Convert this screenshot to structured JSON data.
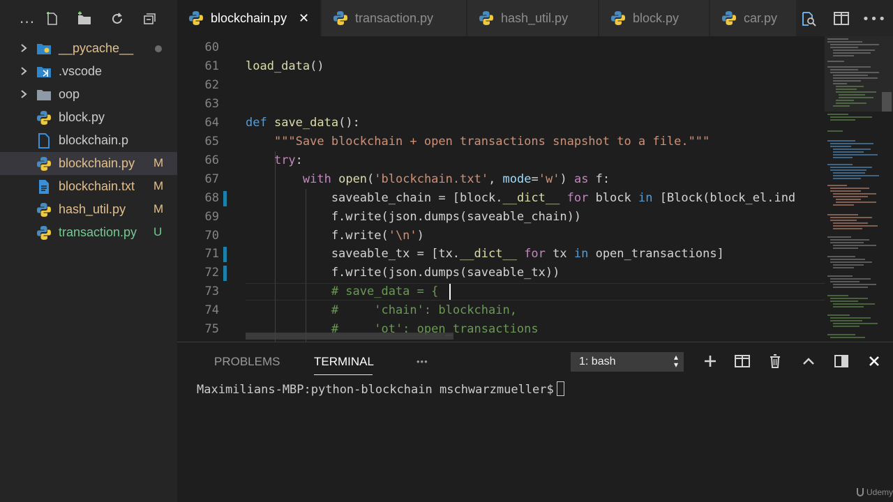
{
  "sidebar": {
    "more_label": "...",
    "items": [
      {
        "label": "__pycache__",
        "icon": "folder-python-icon",
        "color": "#e2c08d",
        "badge": "",
        "dot": true,
        "chevron": true,
        "selected": false
      },
      {
        "label": ".vscode",
        "icon": "folder-vscode-icon",
        "color": "#cccccc",
        "badge": "",
        "dot": false,
        "chevron": true,
        "selected": false
      },
      {
        "label": "oop",
        "icon": "folder-icon",
        "color": "#cccccc",
        "badge": "",
        "dot": false,
        "chevron": true,
        "selected": false
      },
      {
        "label": "block.py",
        "icon": "python-file-icon",
        "color": "#cccccc",
        "badge": "",
        "dot": false,
        "chevron": false,
        "selected": false
      },
      {
        "label": "blockchain.p",
        "icon": "file-icon",
        "color": "#cccccc",
        "badge": "",
        "dot": false,
        "chevron": false,
        "selected": false
      },
      {
        "label": "blockchain.py",
        "icon": "python-file-icon",
        "color": "#e2c08d",
        "badge": "M",
        "dot": false,
        "chevron": false,
        "selected": true
      },
      {
        "label": "blockchain.txt",
        "icon": "text-file-icon",
        "color": "#e2c08d",
        "badge": "M",
        "dot": false,
        "chevron": false,
        "selected": false
      },
      {
        "label": "hash_util.py",
        "icon": "python-file-icon",
        "color": "#e2c08d",
        "badge": "M",
        "dot": false,
        "chevron": false,
        "selected": false
      },
      {
        "label": "transaction.py",
        "icon": "python-file-icon",
        "color": "#73c991",
        "badge": "U",
        "dot": false,
        "chevron": false,
        "selected": false
      }
    ]
  },
  "tabs": [
    {
      "label": "blockchain.py",
      "active": true,
      "close": "✕"
    },
    {
      "label": "transaction.py",
      "active": false
    },
    {
      "label": "hash_util.py",
      "active": false
    },
    {
      "label": "block.py",
      "active": false
    },
    {
      "label": "car.py",
      "active": false
    }
  ],
  "editor": {
    "lines": [
      {
        "n": "60",
        "tokens": []
      },
      {
        "n": "61",
        "tokens": [
          [
            "fn",
            "load_data"
          ],
          [
            "",
            "()"
          ]
        ]
      },
      {
        "n": "62",
        "tokens": []
      },
      {
        "n": "63",
        "tokens": []
      },
      {
        "n": "64",
        "tokens": [
          [
            "kw",
            "def"
          ],
          [
            "",
            " "
          ],
          [
            "fn",
            "save_data"
          ],
          [
            "",
            "():"
          ]
        ]
      },
      {
        "n": "65",
        "tokens": [
          [
            "",
            "    "
          ],
          [
            "str",
            "\"\"\"Save blockchain + open transactions snapshot to a file.\"\"\""
          ]
        ]
      },
      {
        "n": "66",
        "tokens": [
          [
            "",
            "    "
          ],
          [
            "kw2",
            "try"
          ],
          [
            "",
            ":"
          ]
        ]
      },
      {
        "n": "67",
        "tokens": [
          [
            "",
            "        "
          ],
          [
            "kw2",
            "with"
          ],
          [
            "",
            " "
          ],
          [
            "fn",
            "open"
          ],
          [
            "",
            "("
          ],
          [
            "str",
            "'blockchain.txt'"
          ],
          [
            "",
            ", "
          ],
          [
            "var",
            "mode"
          ],
          [
            "",
            "="
          ],
          [
            "str",
            "'w'"
          ],
          [
            "",
            ") "
          ],
          [
            "kw2",
            "as"
          ],
          [
            "",
            " f:"
          ]
        ]
      },
      {
        "n": "68",
        "tokens": [
          [
            "",
            "            saveable_chain = [block."
          ],
          [
            "fn",
            "__dict__"
          ],
          [
            "",
            " "
          ],
          [
            "kw2",
            "for"
          ],
          [
            "",
            " block "
          ],
          [
            "kw",
            "in"
          ],
          [
            "",
            " [Block(block_el.ind"
          ]
        ]
      },
      {
        "n": "69",
        "tokens": [
          [
            "",
            "            f.write(json.dumps(saveable_chain))"
          ]
        ]
      },
      {
        "n": "70",
        "tokens": [
          [
            "",
            "            f.write("
          ],
          [
            "str",
            "'\\n'"
          ],
          [
            "",
            ")"
          ]
        ]
      },
      {
        "n": "71",
        "tokens": [
          [
            "",
            "            saveable_tx = [tx."
          ],
          [
            "fn",
            "__dict__"
          ],
          [
            "",
            " "
          ],
          [
            "kw2",
            "for"
          ],
          [
            "",
            " tx "
          ],
          [
            "kw",
            "in"
          ],
          [
            "",
            " open_transactions]"
          ]
        ]
      },
      {
        "n": "72",
        "tokens": [
          [
            "",
            "            f.write(json.dumps(saveable_tx))"
          ]
        ]
      },
      {
        "n": "73",
        "tokens": [
          [
            "",
            "            "
          ],
          [
            "cm",
            "# save_data = {"
          ]
        ]
      },
      {
        "n": "74",
        "tokens": [
          [
            "",
            "            "
          ],
          [
            "cm",
            "#     'chain': blockchain,"
          ]
        ]
      },
      {
        "n": "75",
        "tokens": [
          [
            "",
            "            "
          ],
          [
            "cm",
            "#     'ot': open_transactions"
          ]
        ]
      }
    ],
    "modified_lines": [
      "68",
      "71",
      "72"
    ]
  },
  "panel": {
    "tabs": [
      {
        "label": "PROBLEMS",
        "active": false
      },
      {
        "label": "TERMINAL",
        "active": true
      },
      {
        "label": "•••",
        "active": false
      }
    ],
    "terminal_select": "1: bash",
    "terminal_prompt": "Maximilians-MBP:python-blockchain mschwarzmueller$"
  },
  "watermark": "Udemy"
}
